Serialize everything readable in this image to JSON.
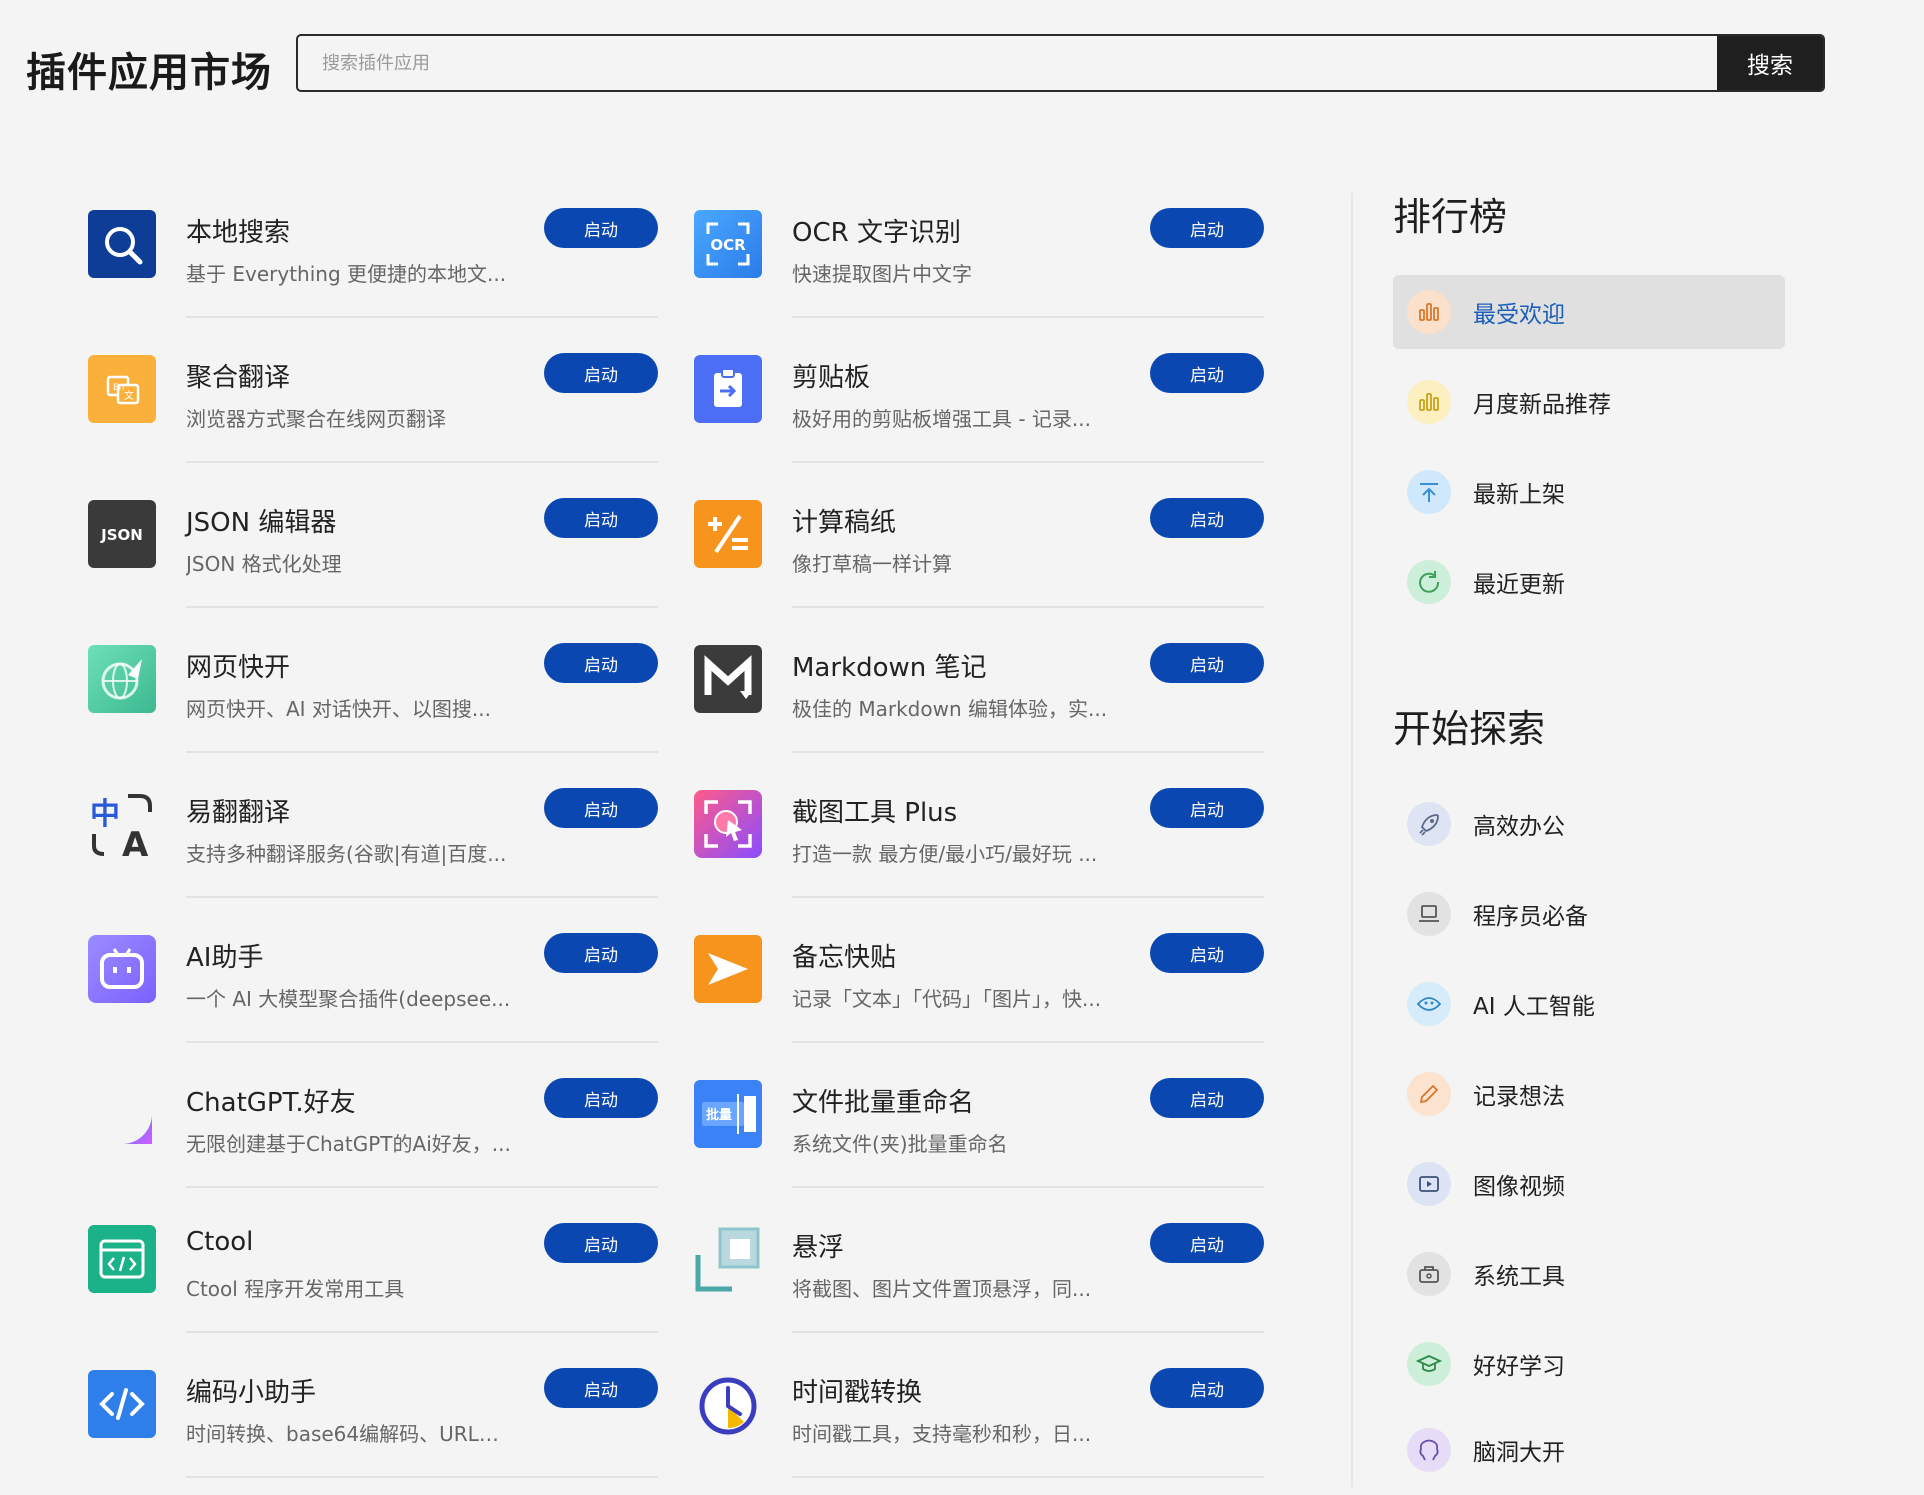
{
  "header": {
    "title": "插件应用市场",
    "search_placeholder": "搜索插件应用",
    "search_button": "搜索"
  },
  "launch_label": "启动",
  "plugins": [
    {
      "name": "本地搜索",
      "desc": "基于 Everything 更便捷的本地文...",
      "icon": "magnifier-icon"
    },
    {
      "name": "OCR 文字识别",
      "desc": "快速提取图片中文字",
      "icon": "ocr-icon"
    },
    {
      "name": "聚合翻译",
      "desc": "浏览器方式聚合在线网页翻译",
      "icon": "translate-icon"
    },
    {
      "name": "剪贴板",
      "desc": "极好用的剪贴板增强工具 - 记录...",
      "icon": "clipboard-icon"
    },
    {
      "name": "JSON 编辑器",
      "desc": "JSON 格式化处理",
      "icon": "json-icon"
    },
    {
      "name": "计算稿纸",
      "desc": "像打草稿一样计算",
      "icon": "calculator-icon"
    },
    {
      "name": "网页快开",
      "desc": "网页快开、AI 对话快开、以图搜...",
      "icon": "globe-rocket-icon"
    },
    {
      "name": "Markdown 笔记",
      "desc": "极佳的 Markdown 编辑体验，实...",
      "icon": "markdown-icon"
    },
    {
      "name": "易翻翻译",
      "desc": "支持多种翻译服务(谷歌|有道|百度...",
      "icon": "zh-a-translate-icon"
    },
    {
      "name": "截图工具 Plus",
      "desc": "打造一款 最方便/最小巧/最好玩 ...",
      "icon": "screenshot-icon"
    },
    {
      "name": "AI助手",
      "desc": "一个 AI 大模型聚合插件(deepsee...",
      "icon": "robot-icon"
    },
    {
      "name": "备忘快贴",
      "desc": "记录「文本」「代码」「图片」，快...",
      "icon": "star-memo-icon"
    },
    {
      "name": "ChatGPT.好友",
      "desc": "无限创建基于ChatGPT的Ai好友，...",
      "icon": "chatgpt-friend-icon"
    },
    {
      "name": "文件批量重命名",
      "desc": "系统文件(夹)批量重命名",
      "icon": "batch-rename-icon"
    },
    {
      "name": "Ctool",
      "desc": "Ctool 程序开发常用工具",
      "icon": "code-window-icon"
    },
    {
      "name": "悬浮",
      "desc": "将截图、图片文件置顶悬浮，同...",
      "icon": "float-window-icon"
    },
    {
      "name": "编码小助手",
      "desc": "时间转换、base64编解码、URL编...",
      "icon": "code-brackets-icon"
    },
    {
      "name": "时间戳转换",
      "desc": "时间戳工具，支持毫秒和秒，日...",
      "icon": "clock-icon"
    }
  ],
  "sidebar": {
    "ranking_title": "排行榜",
    "ranking": [
      {
        "label": "最受欢迎",
        "icon": "bar-chart-icon",
        "active": true
      },
      {
        "label": "月度新品推荐",
        "icon": "bar-chart-icon",
        "active": false
      },
      {
        "label": "最新上架",
        "icon": "upload-icon",
        "active": false
      },
      {
        "label": "最近更新",
        "icon": "refresh-icon",
        "active": false
      }
    ],
    "explore_title": "开始探索",
    "explore": [
      {
        "label": "高效办公",
        "icon": "rocket-icon"
      },
      {
        "label": "程序员必备",
        "icon": "laptop-icon"
      },
      {
        "label": "AI 人工智能",
        "icon": "eye-icon"
      },
      {
        "label": "记录想法",
        "icon": "pencil-icon"
      },
      {
        "label": "图像视频",
        "icon": "play-icon"
      },
      {
        "label": "系统工具",
        "icon": "toolbox-icon"
      },
      {
        "label": "好好学习",
        "icon": "graduation-cap-icon"
      },
      {
        "label": "脑洞大开",
        "icon": "brain-icon"
      }
    ]
  }
}
